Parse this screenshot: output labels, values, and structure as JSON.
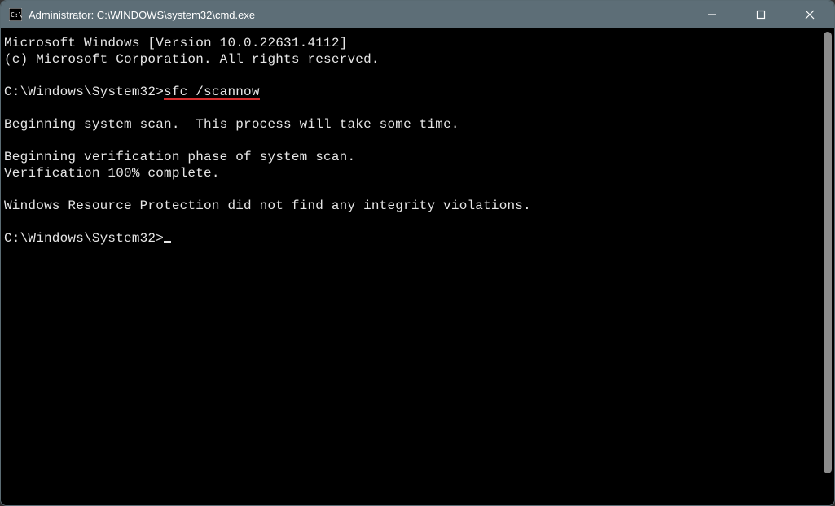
{
  "window": {
    "title": "Administrator: C:\\WINDOWS\\system32\\cmd.exe"
  },
  "terminal": {
    "line1": "Microsoft Windows [Version 10.0.22631.4112]",
    "line2": "(c) Microsoft Corporation. All rights reserved.",
    "blank1": "",
    "prompt1_path": "C:\\Windows\\System32>",
    "prompt1_command": "sfc /scannow",
    "blank2": "",
    "line3": "Beginning system scan.  This process will take some time.",
    "blank3": "",
    "line4": "Beginning verification phase of system scan.",
    "line5": "Verification 100% complete.",
    "blank4": "",
    "line6": "Windows Resource Protection did not find any integrity violations.",
    "blank5": "",
    "prompt2_path": "C:\\Windows\\System32>"
  }
}
